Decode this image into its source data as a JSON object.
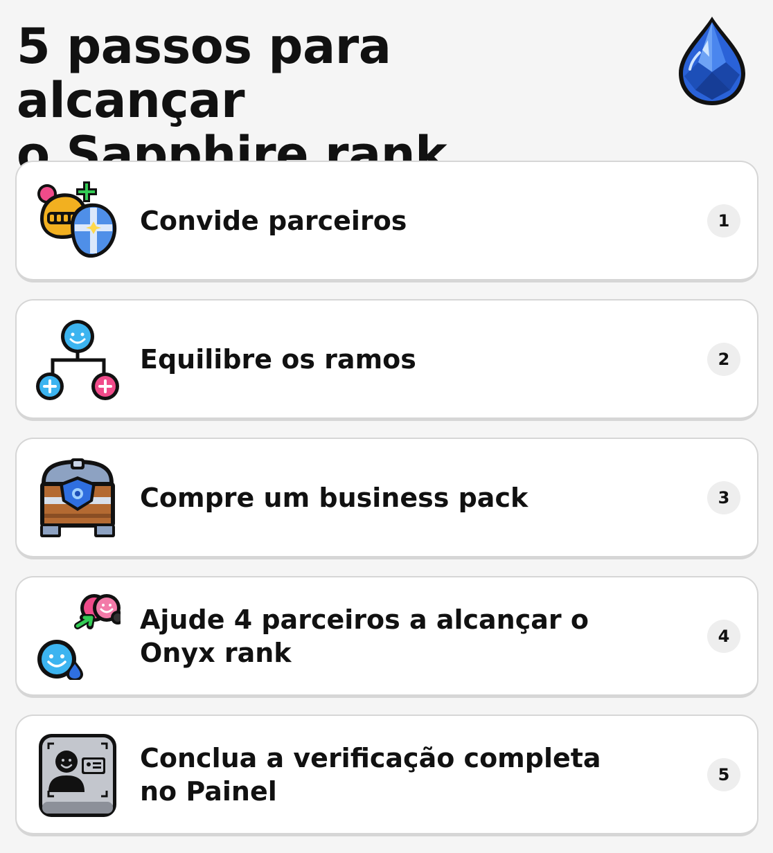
{
  "header": {
    "title_line1": "5 passos para alcançar",
    "title_line2": "o Sapphire rank",
    "gem_icon": "sapphire-gem-icon"
  },
  "steps": [
    {
      "label": "Convide parceiros",
      "number": "1",
      "icon": "partners-helmets-icon"
    },
    {
      "label": "Equilibre os ramos",
      "number": "2",
      "icon": "branches-tree-icon"
    },
    {
      "label": "Compre um business pack",
      "number": "3",
      "icon": "treasure-chest-icon"
    },
    {
      "label": "Ajude 4 parceiros a alcançar o Onyx rank",
      "number": "4",
      "icon": "help-partners-rank-icon"
    },
    {
      "label": "Conclua a verificação completa no Painel",
      "number": "5",
      "icon": "id-verification-icon"
    }
  ],
  "colors": {
    "background": "#f5f5f5",
    "card": "#ffffff",
    "sapphire": "#2f6fe0",
    "badge": "#eeeeee"
  }
}
